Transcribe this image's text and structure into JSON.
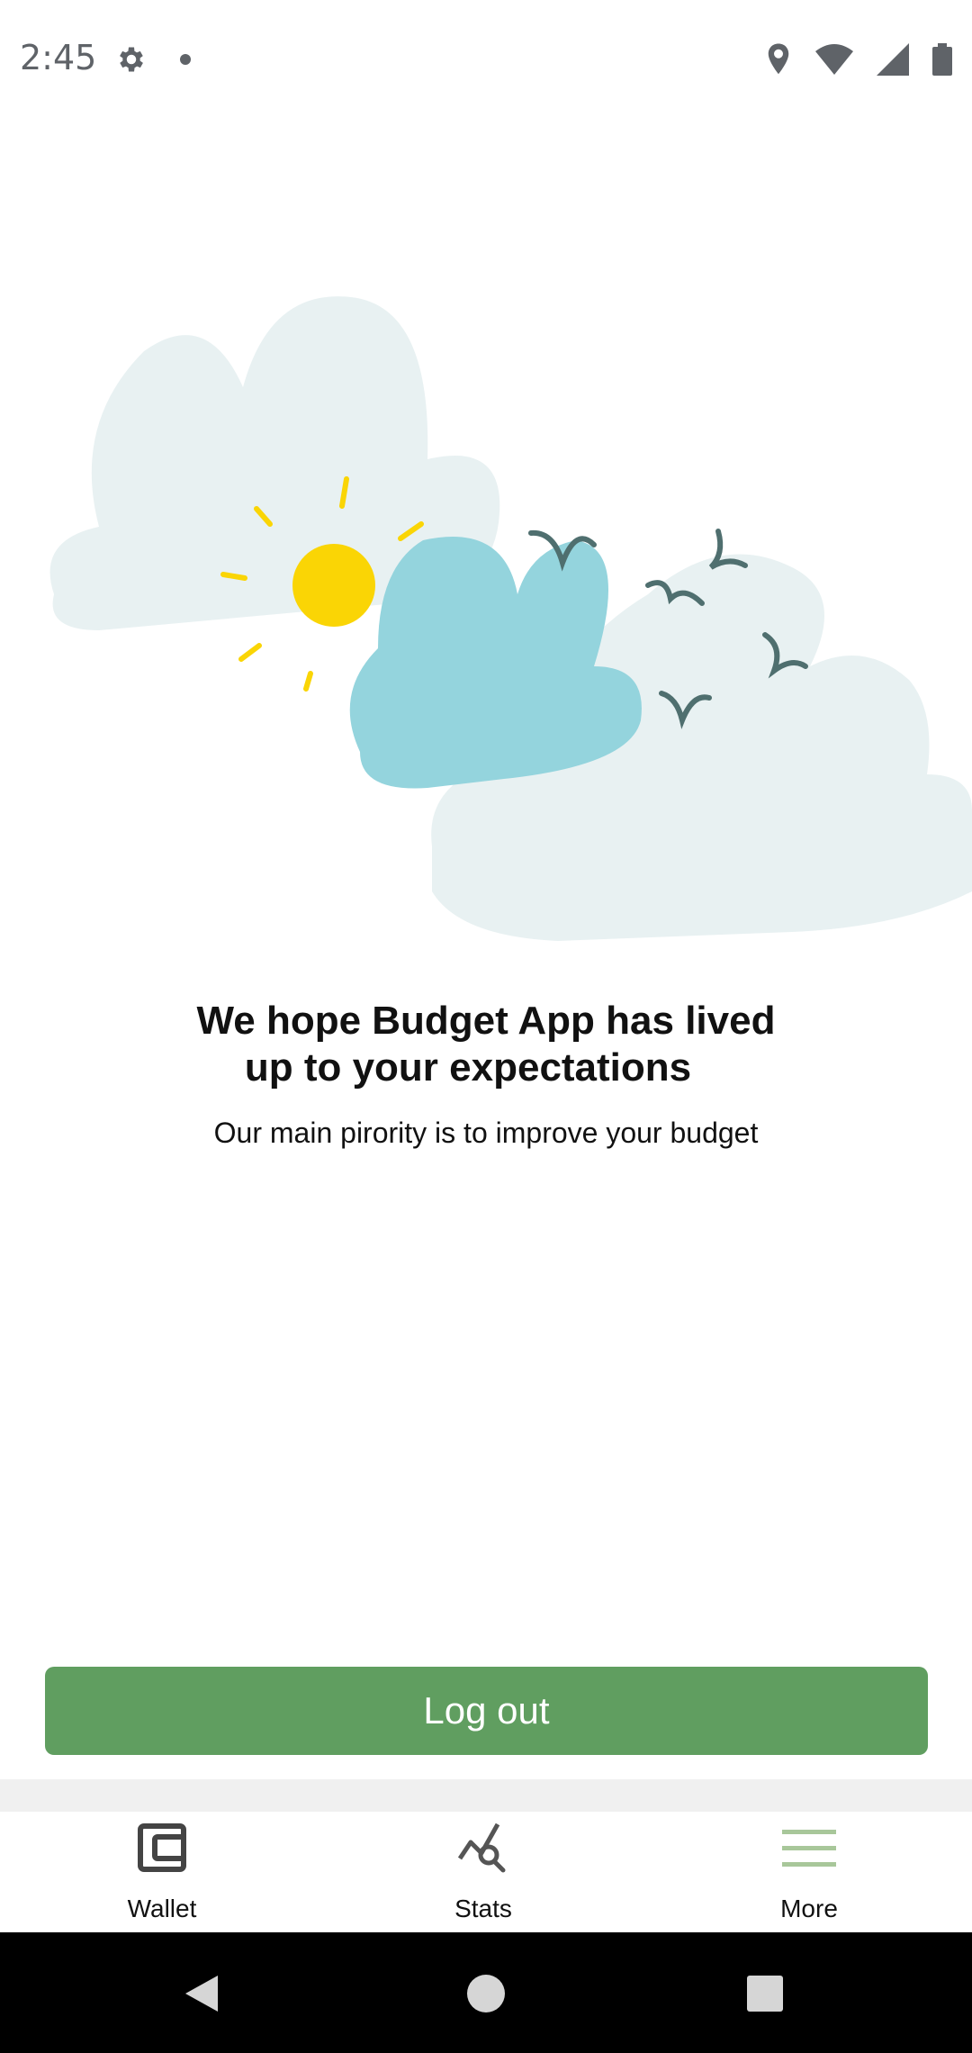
{
  "status_bar": {
    "time": "2:45",
    "icons": [
      "settings-icon",
      "notification-dot-icon",
      "location-icon",
      "wifi-icon",
      "signal-icon",
      "battery-icon"
    ]
  },
  "content": {
    "headline_line1": "We hope Budget App has lived",
    "headline_line2": "up to your expectations",
    "subline": "Our main pirority is to improve your budget",
    "logout_label": "Log out"
  },
  "bottom_nav": {
    "items": [
      {
        "label": "Wallet",
        "icon": "wallet-icon"
      },
      {
        "label": "Stats",
        "icon": "stats-icon"
      },
      {
        "label": "More",
        "icon": "menu-icon"
      }
    ]
  },
  "system_nav": {
    "buttons": [
      "back-icon",
      "home-icon",
      "recents-icon"
    ]
  },
  "colors": {
    "primary": "#609e60",
    "more_icon": "#a8c79a",
    "sun": "#fad505",
    "cloud_light": "#e8f1f2",
    "cloud_blue": "#94d4dd",
    "birds": "#4f6f6f"
  }
}
